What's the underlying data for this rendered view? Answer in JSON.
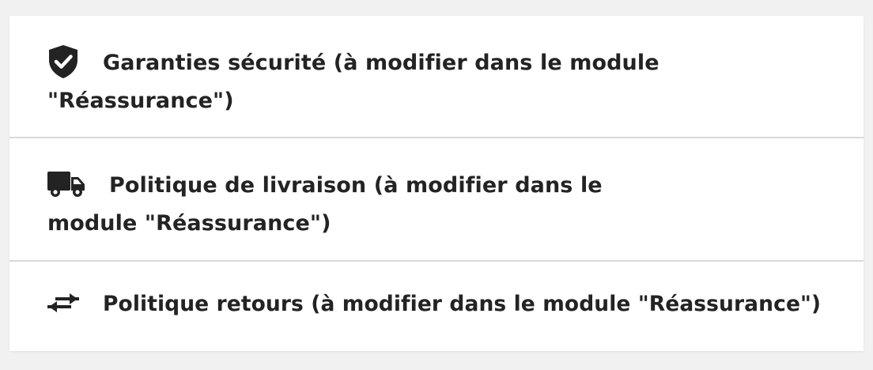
{
  "reassurance": {
    "items": [
      {
        "icon": "shield-check-icon",
        "label": "Garanties sécurité (à modifier dans le module \"Réassurance\")"
      },
      {
        "icon": "truck-icon",
        "label": "Politique de livraison (à modifier dans le module \"Réassurance\")"
      },
      {
        "icon": "swap-arrows-icon",
        "label": "Politique retours (à modifier dans le module \"Réassurance\")"
      }
    ]
  },
  "colors": {
    "text": "#232323",
    "icon": "#232323",
    "divider": "#d9d9d9",
    "background": "#f1f1f1",
    "card": "#ffffff"
  }
}
